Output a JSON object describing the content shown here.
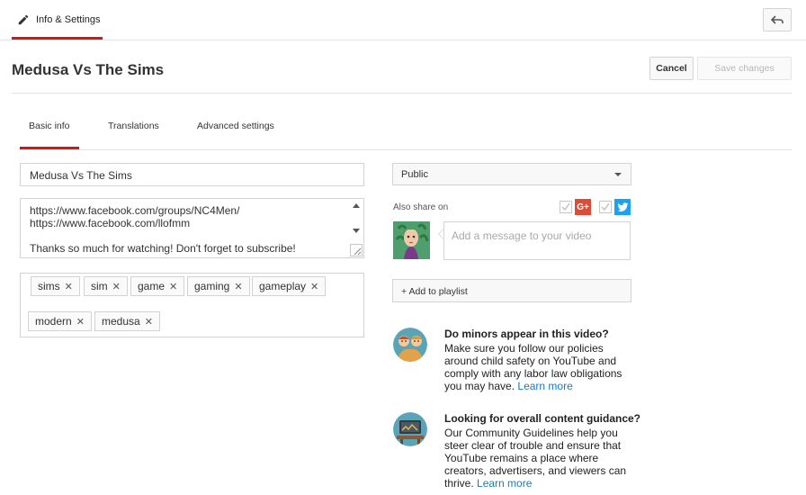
{
  "top_tab": {
    "label": "Info & Settings"
  },
  "header": {
    "title": "Medusa Vs The Sims",
    "cancel_label": "Cancel",
    "save_label": "Save changes"
  },
  "subtabs": [
    {
      "label": "Basic info"
    },
    {
      "label": "Translations"
    },
    {
      "label": "Advanced settings"
    }
  ],
  "basic": {
    "title_value": "Medusa Vs The Sims",
    "description_lines": [
      "https://www.facebook.com/groups/NC4Men/",
      "https://www.facebook.com/llofmm",
      "",
      "Thanks so much for watching! Don't forget to subscribe!"
    ],
    "tags": [
      "sims",
      "sim",
      "game",
      "gaming",
      "gameplay",
      "modern",
      "medusa"
    ]
  },
  "right": {
    "privacy": "Public",
    "share_label": "Also share on",
    "share_gplus": "G+",
    "message_placeholder": "Add a message to your video",
    "playlist_label": "+ Add to playlist"
  },
  "info_minors": {
    "title": "Do minors appear in this video?",
    "text": "Make sure you follow our policies around child safety on YouTube and comply with any labor law obligations you may have.",
    "link": "Learn more"
  },
  "info_guidance": {
    "title": "Looking for overall content guidance?",
    "text": "Our Community Guidelines help you steer clear of trouble and ensure that YouTube remains a place where creators, advertisers, and viewers can thrive.",
    "link": "Learn more"
  },
  "colors": {
    "accent_red": "#cc181e",
    "link_blue": "#167ac6",
    "gplus_red": "#dd4b39",
    "twitter_blue": "#1da1f2"
  }
}
